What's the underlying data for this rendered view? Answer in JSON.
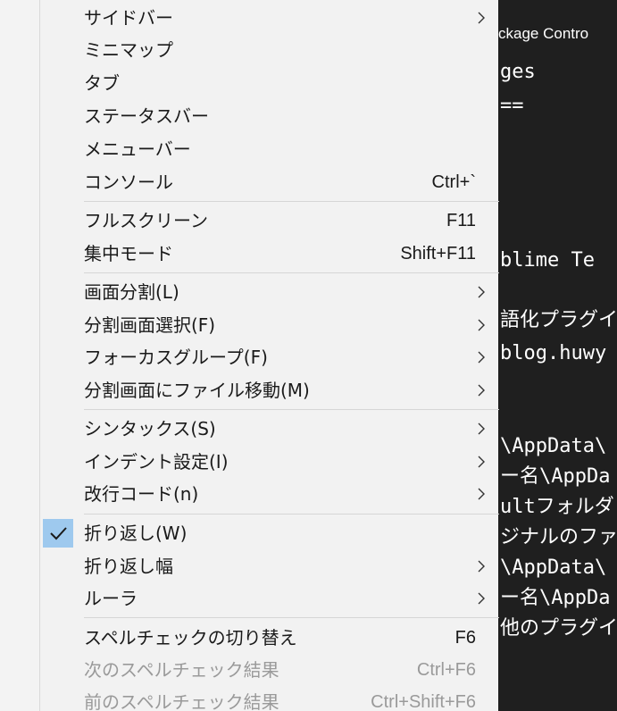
{
  "editor": {
    "tab_title": "ckage Contro",
    "lines": [
      "ges",
      "==",
      "blime Te",
      "語化プラグイ",
      "blog.huwy",
      "\\AppData\\",
      "ー名\\AppDa",
      "ultフォルダ",
      "ジナルのファイ",
      "\\AppData\\",
      "ー名\\AppDa",
      "他のプラグイ"
    ]
  },
  "menu": {
    "items": [
      {
        "label": "サイドバー",
        "shortcut": "",
        "submenu": true
      },
      {
        "label": "ミニマップ",
        "shortcut": "",
        "submenu": false
      },
      {
        "label": "タブ",
        "shortcut": "",
        "submenu": false
      },
      {
        "label": "ステータスバー",
        "shortcut": "",
        "submenu": false
      },
      {
        "label": "メニューバー",
        "shortcut": "",
        "submenu": false
      },
      {
        "label": "コンソール",
        "shortcut": "Ctrl+`",
        "submenu": false
      },
      {
        "label": "フルスクリーン",
        "shortcut": "F11",
        "submenu": false
      },
      {
        "label": "集中モード",
        "shortcut": "Shift+F11",
        "submenu": false
      },
      {
        "label": "画面分割(L)",
        "shortcut": "",
        "submenu": true
      },
      {
        "label": "分割画面選択(F)",
        "shortcut": "",
        "submenu": true
      },
      {
        "label": "フォーカスグループ(F)",
        "shortcut": "",
        "submenu": true
      },
      {
        "label": "分割画面にファイル移動(M)",
        "shortcut": "",
        "submenu": true
      },
      {
        "label": "シンタックス(S)",
        "shortcut": "",
        "submenu": true
      },
      {
        "label": "インデント設定(I)",
        "shortcut": "",
        "submenu": true
      },
      {
        "label": "改行コード(n)",
        "shortcut": "",
        "submenu": true
      },
      {
        "label": "折り返し(W)",
        "shortcut": "",
        "submenu": false,
        "checked": true
      },
      {
        "label": "折り返し幅",
        "shortcut": "",
        "submenu": true
      },
      {
        "label": "ルーラ",
        "shortcut": "",
        "submenu": true
      },
      {
        "label": "スペルチェックの切り替え",
        "shortcut": "F6",
        "submenu": false
      },
      {
        "label": "次のスペルチェック結果",
        "shortcut": "Ctrl+F6",
        "submenu": false,
        "disabled": true
      },
      {
        "label": "前のスペルチェック結果",
        "shortcut": "Ctrl+Shift+F6",
        "submenu": false,
        "disabled": true
      }
    ]
  },
  "icons": {
    "check": "checkmark-icon",
    "submenu": "chevron-right-icon"
  },
  "colors": {
    "menu_bg": "#f2f2f2",
    "check_bg": "#9ec9ee",
    "check_mark": "#1a1a1a",
    "disabled_text": "#9a9a9a",
    "editor_bg": "#1f1f1f"
  }
}
